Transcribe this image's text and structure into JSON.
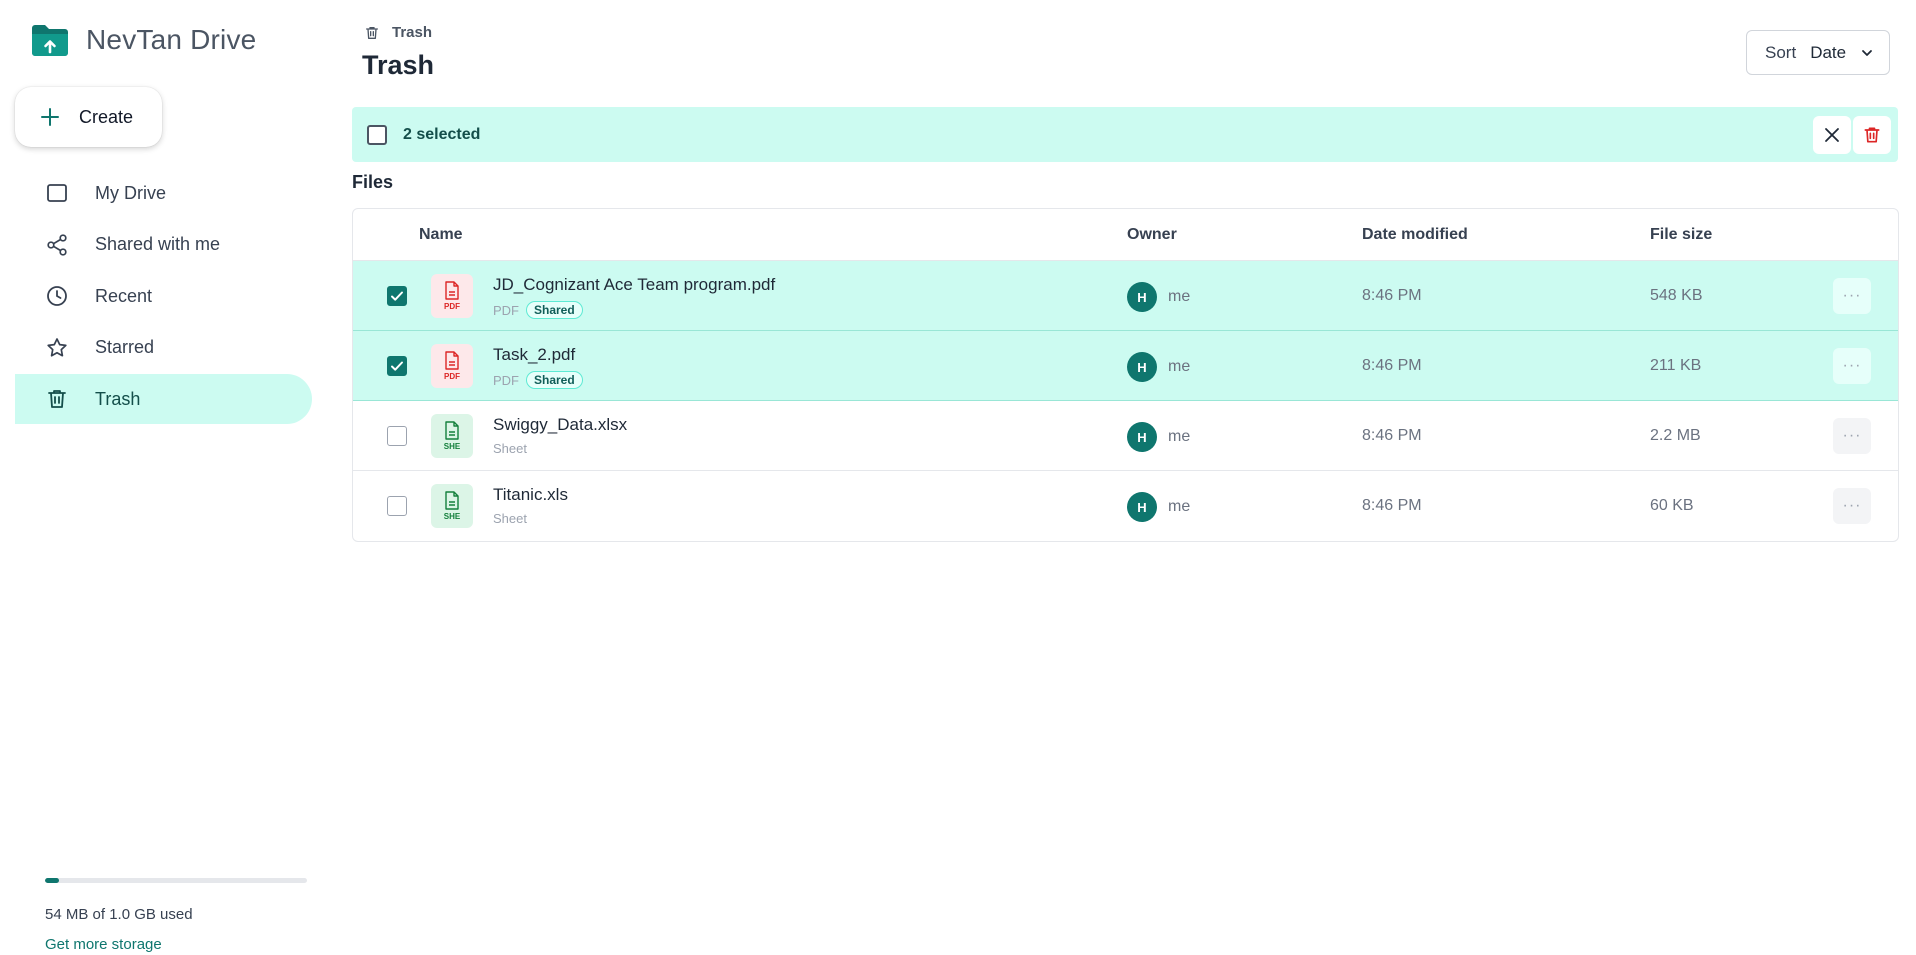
{
  "app": {
    "name": "NevTan Drive",
    "brand_color": "#0f766e",
    "logo_icon": "folder-upload-icon"
  },
  "sidebar": {
    "create_label": "Create",
    "items": [
      {
        "label": "My Drive",
        "icon": "drive-icon",
        "active": false
      },
      {
        "label": "Shared with me",
        "icon": "share-icon",
        "active": false
      },
      {
        "label": "Recent",
        "icon": "clock-icon",
        "active": false
      },
      {
        "label": "Starred",
        "icon": "star-icon",
        "active": false
      },
      {
        "label": "Trash",
        "icon": "trash-icon",
        "active": true
      }
    ],
    "storage": {
      "used_fraction": 0.054,
      "text": "54 MB of 1.0 GB used",
      "link": "Get more storage"
    }
  },
  "header": {
    "breadcrumb": "Trash",
    "title": "Trash",
    "sort_label": "Sort",
    "sort_value": "Date"
  },
  "selection": {
    "count_text": "2 selected"
  },
  "files": {
    "section_label": "Files",
    "columns": {
      "name": "Name",
      "owner": "Owner",
      "date": "Date modified",
      "size": "File size"
    },
    "rows": [
      {
        "name": "JD_Cognizant Ace Team program.pdf",
        "type": "PDF",
        "icon_tag": "PDF",
        "kind": "pdf",
        "badge": "Shared",
        "owner_initial": "H",
        "owner": "me",
        "date": "8:46 PM",
        "size": "548 KB",
        "selected": true,
        "more": "···"
      },
      {
        "name": "Task_2.pdf",
        "type": "PDF",
        "icon_tag": "PDF",
        "kind": "pdf",
        "badge": "Shared",
        "owner_initial": "H",
        "owner": "me",
        "date": "8:46 PM",
        "size": "211 KB",
        "selected": true,
        "more": "···"
      },
      {
        "name": "Swiggy_Data.xlsx",
        "type": "Sheet",
        "icon_tag": "SHE",
        "kind": "sheet",
        "badge": "",
        "owner_initial": "H",
        "owner": "me",
        "date": "8:46 PM",
        "size": "2.2 MB",
        "selected": false,
        "more": "···"
      },
      {
        "name": "Titanic.xls",
        "type": "Sheet",
        "icon_tag": "SHE",
        "kind": "sheet",
        "badge": "",
        "owner_initial": "H",
        "owner": "me",
        "date": "8:46 PM",
        "size": "60 KB",
        "selected": false,
        "more": "···"
      }
    ]
  }
}
